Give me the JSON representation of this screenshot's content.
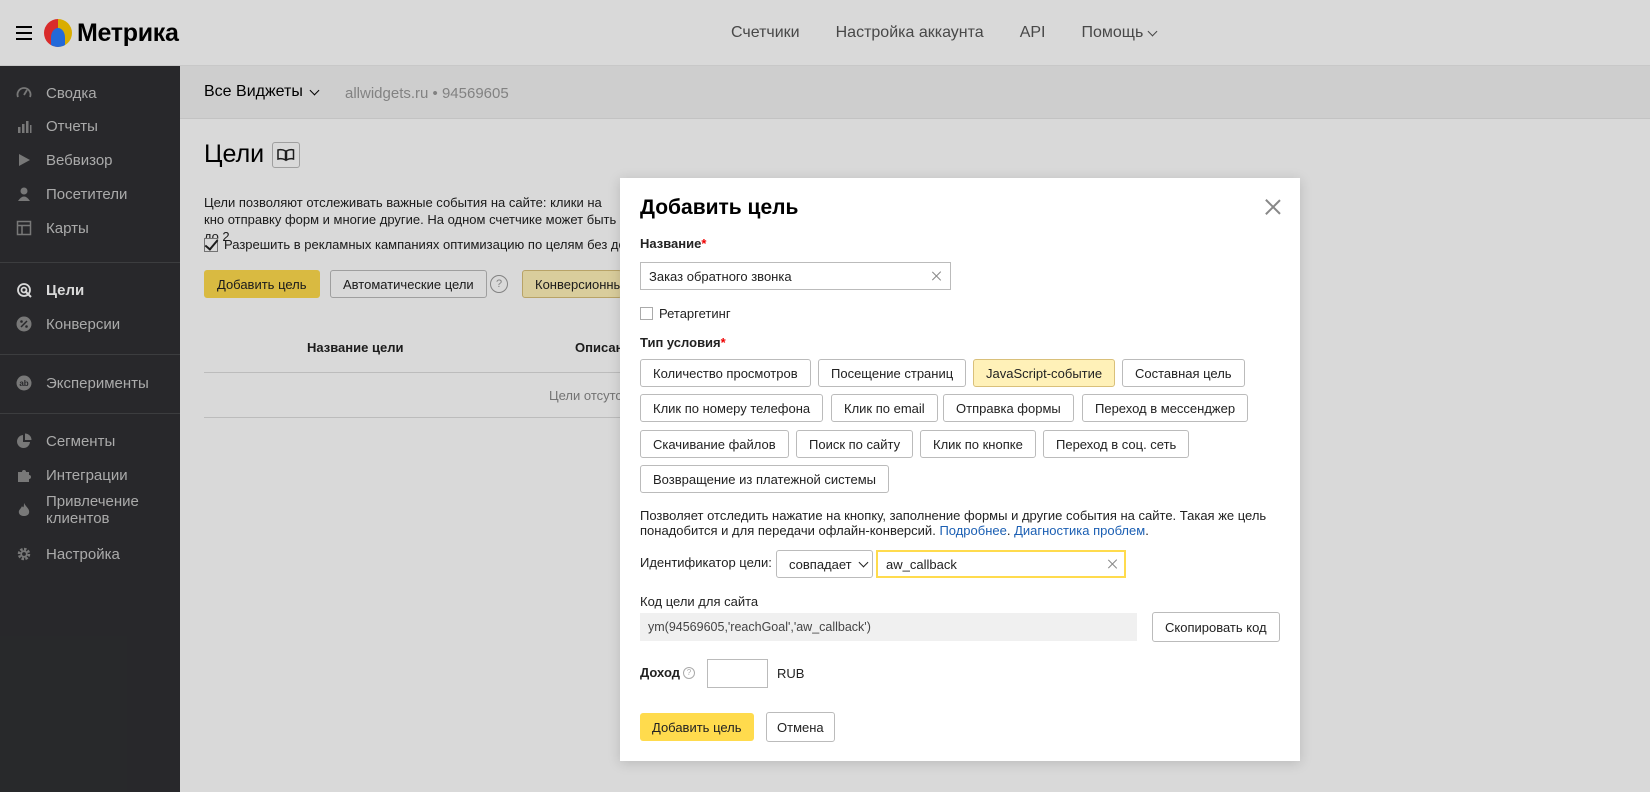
{
  "header": {
    "brand": "Метрика",
    "nav": [
      "Счетчики",
      "Настройка аккаунта",
      "API",
      "Помощь"
    ]
  },
  "sidebar": {
    "items": [
      {
        "label": "Сводка",
        "icon": "gauge-icon"
      },
      {
        "label": "Отчеты",
        "icon": "bar-chart-icon"
      },
      {
        "label": "Вебвизор",
        "icon": "play-icon"
      },
      {
        "label": "Посетители",
        "icon": "person-icon"
      },
      {
        "label": "Карты",
        "icon": "map-layout-icon"
      },
      {
        "label": "Цели",
        "icon": "target-icon",
        "active": true
      },
      {
        "label": "Конверсии",
        "icon": "percent-icon"
      },
      {
        "label": "Эксперименты",
        "icon": "ab-icon"
      },
      {
        "label": "Сегменты",
        "icon": "pie-icon"
      },
      {
        "label": "Интеграции",
        "icon": "puzzle-icon"
      },
      {
        "label": "Привлечение клиентов",
        "icon": "flame-icon"
      },
      {
        "label": "Настройка",
        "icon": "gear-icon"
      }
    ]
  },
  "counter": {
    "name": "Все Виджеты",
    "meta": "allwidgets.ru • 94569605"
  },
  "page": {
    "title": "Цели",
    "description": "Цели позволяют отслеживать важные события на сайте: клики на кно отправку форм и многие другие. На одном счетчике может быть до 2",
    "checkbox_label": "Разрешить в рекламных кампаниях оптимизацию по целям без до",
    "add_goal": "Добавить цель",
    "auto_goals": "Автоматические цели",
    "conversion": "Конверсионны",
    "col_name": "Название цели",
    "col_desc": "Описан",
    "empty": "Цели отсутс"
  },
  "modal": {
    "title": "Добавить цель",
    "name_label": "Название",
    "name_value": "Заказ обратного звонка",
    "retargeting": "Ретаргетинг",
    "type_label": "Тип условия",
    "types": [
      "Количество просмотров",
      "Посещение страниц",
      "JavaScript-событие",
      "Составная цель",
      "Клик по номеру телефона",
      "Клик по email",
      "Отправка формы",
      "Переход в мессенджер",
      "Скачивание файлов",
      "Поиск по сайту",
      "Клик по кнопке",
      "Переход в соц. сеть",
      "Возвращение из платежной системы"
    ],
    "selected_type": "JavaScript-событие",
    "info_text": "Позволяет отследить нажатие на кнопку, заполнение формы и другие события на сайте. Такая же цель понадобится и для передачи офлайн-конверсий.",
    "info_link1": "Подробнее",
    "info_link2": "Диагностика проблем",
    "id_label": "Идентификатор цели:",
    "match": "совпадает",
    "id_value": "aw_callback",
    "code_label": "Код цели для сайта",
    "code": "ym(94569605,'reachGoal','aw_callback')",
    "copy": "Скопировать код",
    "income_label": "Доход",
    "income_value": "",
    "currency": "RUB",
    "submit": "Добавить цель",
    "cancel": "Отмена"
  }
}
